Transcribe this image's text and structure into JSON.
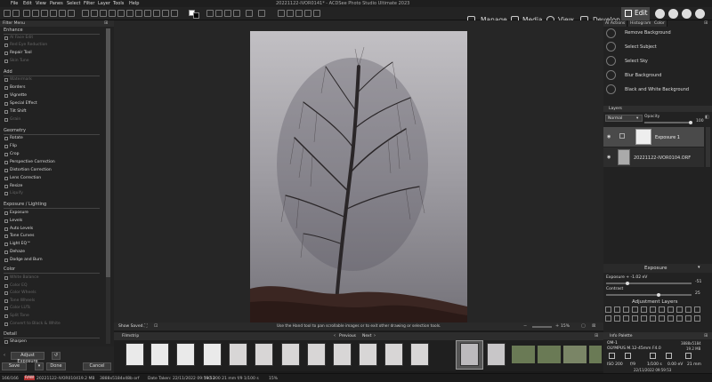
{
  "window": {
    "title": "20221122-IVOR0141* - ACDSee Photo Studio Ultimate 2023"
  },
  "menu": [
    "File",
    "Edit",
    "View",
    "Panes",
    "Select",
    "Filter",
    "Layer",
    "Tools",
    "Help"
  ],
  "modes": {
    "manage": "Manage",
    "media": "Media",
    "view": "View",
    "develop": "Develop",
    "edit": "Edit"
  },
  "left_panel": {
    "title": "Filter Menu",
    "sections": [
      {
        "title": "Enhance",
        "items": [
          {
            "label": "AI Face Edit",
            "disabled": true
          },
          {
            "label": "Red Eye Reduction",
            "disabled": true
          },
          {
            "label": "Repair Tool",
            "disabled": false
          },
          {
            "label": "Skin Tune",
            "disabled": true
          }
        ]
      },
      {
        "title": "Add",
        "items": [
          {
            "label": "Watermark",
            "disabled": true
          },
          {
            "label": "Borders",
            "disabled": false
          },
          {
            "label": "Vignette",
            "disabled": false
          },
          {
            "label": "Special Effect",
            "disabled": false
          },
          {
            "label": "Tilt Shift",
            "disabled": false
          },
          {
            "label": "Grain",
            "disabled": true
          }
        ]
      },
      {
        "title": "Geometry",
        "items": [
          {
            "label": "Rotate",
            "disabled": false
          },
          {
            "label": "Flip",
            "disabled": false
          },
          {
            "label": "Crop",
            "disabled": false
          },
          {
            "label": "Perspective Correction",
            "disabled": false
          },
          {
            "label": "Distortion Correction",
            "disabled": false
          },
          {
            "label": "Lens Correction",
            "disabled": false
          },
          {
            "label": "Resize",
            "disabled": false
          },
          {
            "label": "Liquify",
            "disabled": true
          }
        ]
      },
      {
        "title": "Exposure / Lighting",
        "items": [
          {
            "label": "Exposure",
            "disabled": false
          },
          {
            "label": "Levels",
            "disabled": false
          },
          {
            "label": "Auto Levels",
            "disabled": false
          },
          {
            "label": "Tone Curves",
            "disabled": false
          },
          {
            "label": "Light EQ™",
            "disabled": false
          },
          {
            "label": "Dehaze",
            "disabled": false
          },
          {
            "label": "Dodge and Burn",
            "disabled": false
          }
        ]
      },
      {
        "title": "Color",
        "items": [
          {
            "label": "White Balance",
            "disabled": true
          },
          {
            "label": "Color EQ",
            "disabled": true
          },
          {
            "label": "Color Wheels",
            "disabled": true
          },
          {
            "label": "Tone Wheels",
            "disabled": true
          },
          {
            "label": "Color LUTs",
            "disabled": true
          },
          {
            "label": "Split Tone",
            "disabled": true
          },
          {
            "label": "Convert to Black & White",
            "disabled": true
          }
        ]
      },
      {
        "title": "Detail",
        "items": [
          {
            "label": "Sharpen",
            "disabled": false
          }
        ]
      }
    ],
    "adjust_label": "Adjust Exposure",
    "save": "Save",
    "done": "Done",
    "cancel": "Cancel"
  },
  "canvas": {
    "show_saved": "Show Saved",
    "hint": "Use the Hand tool to pan scrollable images or to exit other drawing or selection tools.",
    "zoom": "15%"
  },
  "filmstrip": {
    "title": "Filmstrip",
    "previous": "Previous",
    "next": "Next"
  },
  "right_panel": {
    "tabs": [
      "AI Actions",
      "Histogram",
      "Color"
    ],
    "ai_actions": [
      "Remove Background",
      "Select Subject",
      "Select Sky",
      "Blur Background",
      "Black and White Background"
    ],
    "layers_title": "Layers",
    "blend_mode": "Normal",
    "opacity_label": "Opacity",
    "opacity_value": "100",
    "layers": [
      "Exposure 1",
      "20221122-IVOR0104.ORF"
    ],
    "exposure_title": "Exposure",
    "exposure_label": "Exposure + -1.02 eV",
    "exposure_value": "-51",
    "contrast_label": "Contrast",
    "contrast_value": "25",
    "adjustment_layers": "Adjustment Layers",
    "info_title": "Info Palette",
    "info": {
      "camera": "OM-1",
      "lens": "OLYMPUS M.12-45mm F4.0",
      "dims": "3888x5184",
      "size": "19.2 MB",
      "iso": "ISO 200",
      "fstop": "f/9",
      "shutter": "1/100 s",
      "ev": "0.00 eV",
      "focal": "21 mm",
      "date": "22/11/2022 09:59:53"
    }
  },
  "status": {
    "count": "166/166",
    "badge": "RAW",
    "file": "20221122-IVOR0104",
    "size": "19.2 MB",
    "dims": "3888x5184x48b orf",
    "date": "Date Taken: 22/11/2022 09:59:53",
    "exif": "ISO 200  21 mm  f/9  1/100 s",
    "zoom": "15%"
  }
}
